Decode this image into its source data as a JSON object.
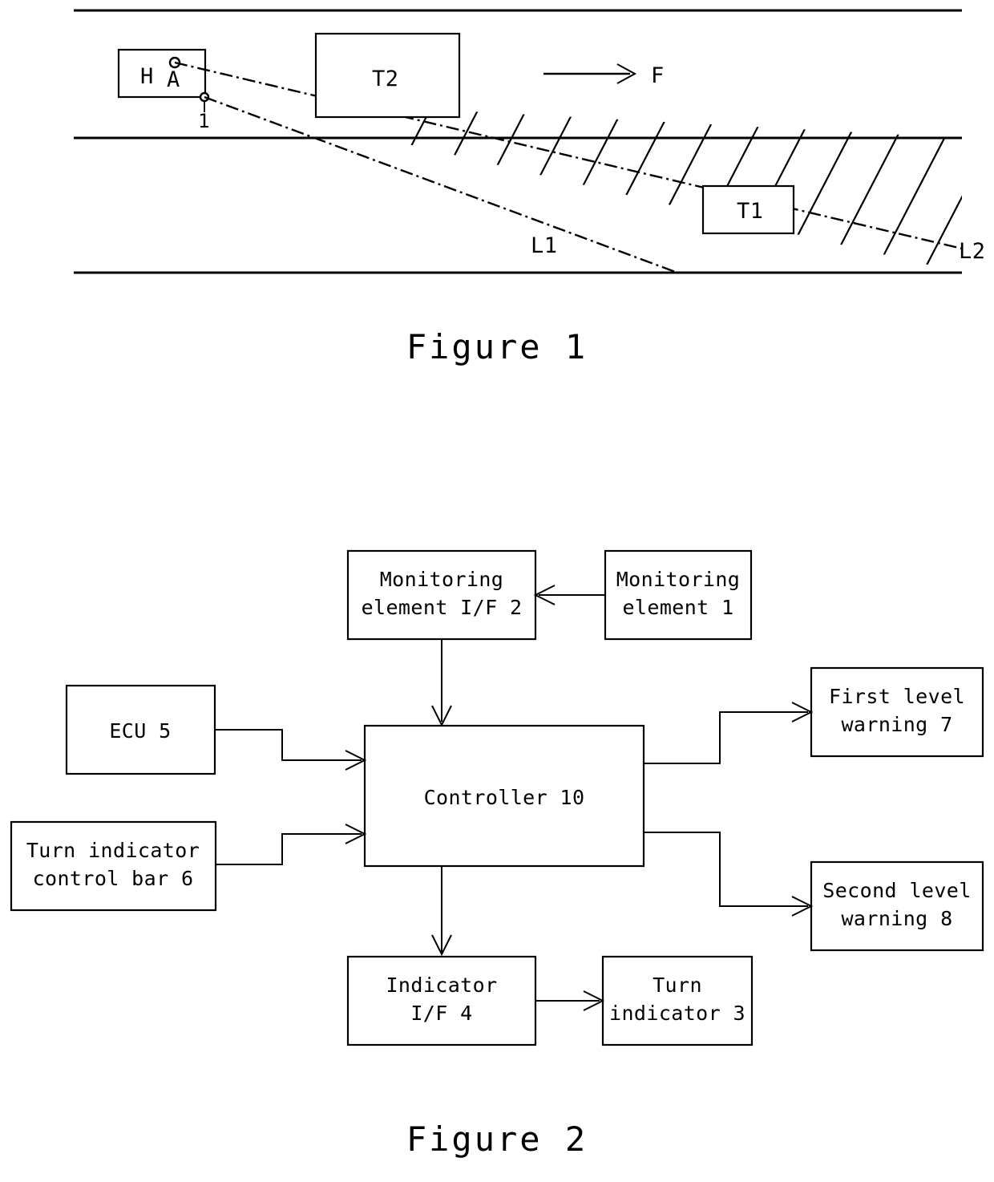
{
  "document": {
    "type": "patent-drawing-sheet"
  },
  "figure1": {
    "caption": "Figure 1",
    "labels": {
      "host_vehicle": "H",
      "driver": "A",
      "sensor": "1",
      "other_vehicle_front": "T2",
      "other_vehicle_rear": "T1",
      "blind_spot_near_boundary": "L1",
      "blind_spot_far_boundary": "L2",
      "travel_direction": "F"
    },
    "elements": {
      "road_lines": 3,
      "hatched_region": "blind spot area",
      "direction_arrow": "rightward arrow"
    }
  },
  "figure2": {
    "caption": "Figure 2",
    "blocks": [
      {
        "id": "monitoring-element-if",
        "label_line1": "Monitoring",
        "label_line2": "element I/F 2"
      },
      {
        "id": "monitoring-element",
        "label_line1": "Monitoring",
        "label_line2": "element 1"
      },
      {
        "id": "ecu",
        "label_line1": "ECU 5",
        "label_line2": ""
      },
      {
        "id": "turn-indicator-control-bar",
        "label_line1": "Turn indicator",
        "label_line2": "control bar 6"
      },
      {
        "id": "controller",
        "label_line1": "Controller 10",
        "label_line2": ""
      },
      {
        "id": "first-level-warning",
        "label_line1": "First level",
        "label_line2": "warning 7"
      },
      {
        "id": "second-level-warning",
        "label_line1": "Second level",
        "label_line2": "warning 8"
      },
      {
        "id": "indicator-if",
        "label_line1": "Indicator",
        "label_line2": "I/F 4"
      },
      {
        "id": "turn-indicator",
        "label_line1": "Turn",
        "label_line2": "indicator 3"
      }
    ],
    "connections": [
      {
        "from": "monitoring-element",
        "to": "monitoring-element-if"
      },
      {
        "from": "monitoring-element-if",
        "to": "controller"
      },
      {
        "from": "ecu",
        "to": "controller"
      },
      {
        "from": "turn-indicator-control-bar",
        "to": "controller"
      },
      {
        "from": "controller",
        "to": "first-level-warning"
      },
      {
        "from": "controller",
        "to": "second-level-warning"
      },
      {
        "from": "controller",
        "to": "indicator-if"
      },
      {
        "from": "indicator-if",
        "to": "turn-indicator"
      }
    ]
  },
  "colors": {
    "ink": "#000000",
    "paper": "#ffffff"
  }
}
